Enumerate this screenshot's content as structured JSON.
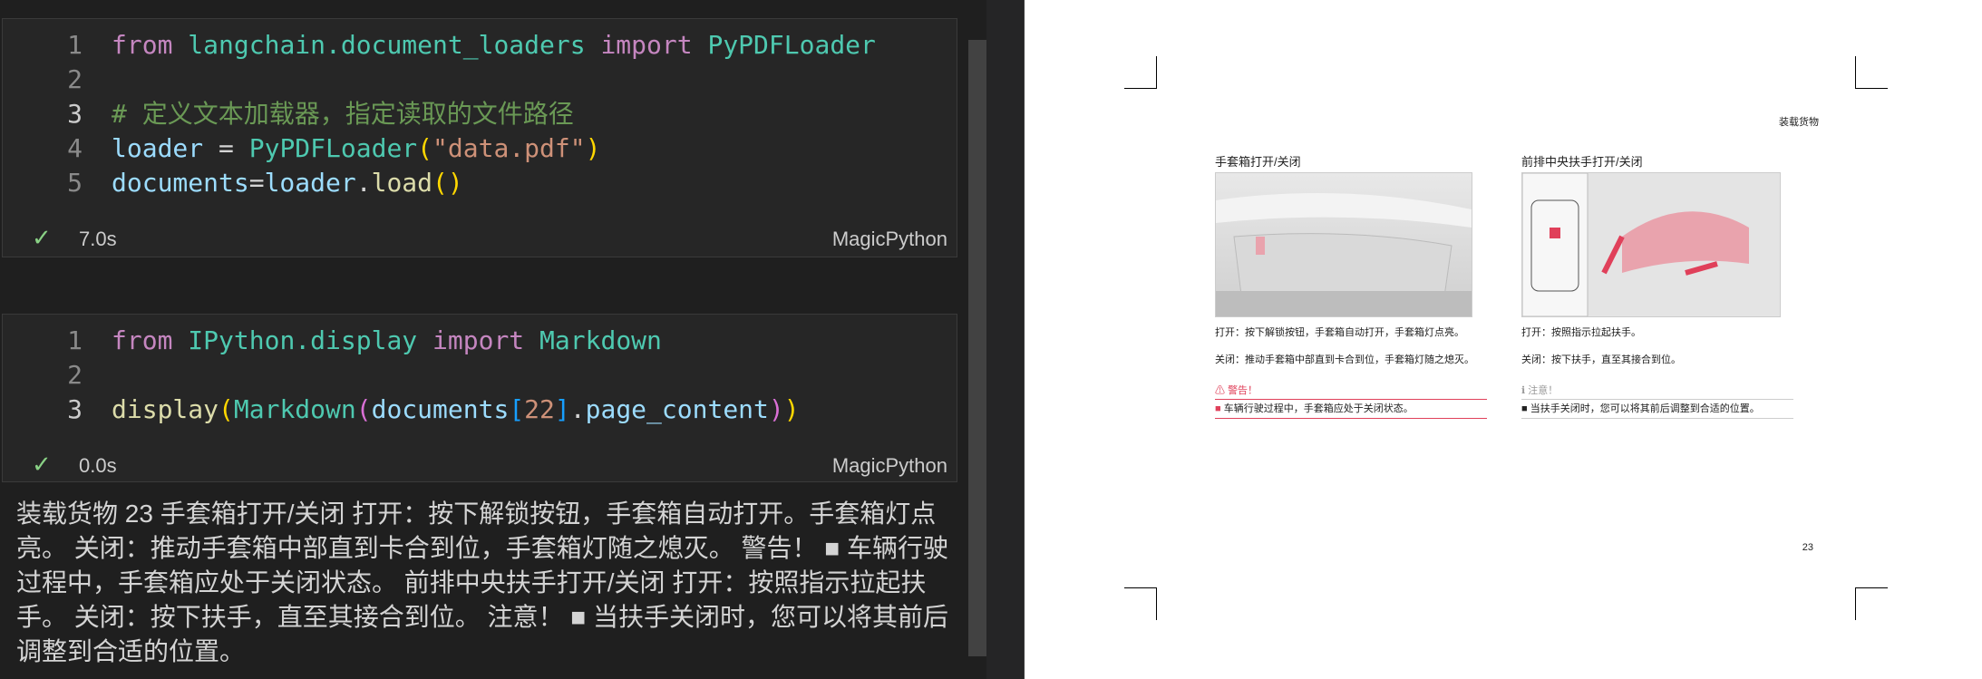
{
  "cell1": {
    "lines": [
      {
        "n": "1",
        "tokens": [
          [
            "kw",
            "from "
          ],
          [
            "mod",
            "langchain.document_loaders "
          ],
          [
            "kw",
            "import "
          ],
          [
            "cls",
            "PyPDFLoader"
          ]
        ]
      },
      {
        "n": "2",
        "tokens": []
      },
      {
        "n": "3",
        "tokens": [
          [
            "cmt",
            "# 定义文本加载器，指定读取的文件路径"
          ]
        ]
      },
      {
        "n": "4",
        "tokens": [
          [
            "var",
            "loader "
          ],
          [
            "pn",
            "= "
          ],
          [
            "cls",
            "PyPDFLoader"
          ],
          [
            "br1",
            "("
          ],
          [
            "str",
            "\"data.pdf\""
          ],
          [
            "br1",
            ")"
          ]
        ]
      },
      {
        "n": "5",
        "tokens": [
          [
            "var",
            "documents"
          ],
          [
            "pn",
            "="
          ],
          [
            "var",
            "loader"
          ],
          [
            "pn",
            "."
          ],
          [
            "fn",
            "load"
          ],
          [
            "br1",
            "()"
          ]
        ]
      }
    ],
    "time": "7.0s",
    "language": "MagicPython"
  },
  "cell2": {
    "lines": [
      {
        "n": "1",
        "tokens": [
          [
            "kw",
            "from "
          ],
          [
            "mod",
            "IPython.display "
          ],
          [
            "kw",
            "import "
          ],
          [
            "cls",
            "Markdown"
          ]
        ]
      },
      {
        "n": "2",
        "tokens": []
      },
      {
        "n": "3",
        "tokens": [
          [
            "fn",
            "display"
          ],
          [
            "br1",
            "("
          ],
          [
            "cls",
            "Markdown"
          ],
          [
            "br2",
            "("
          ],
          [
            "var",
            "documents"
          ],
          [
            "br3",
            "["
          ],
          [
            "str",
            "22"
          ],
          [
            "br3",
            "]"
          ],
          [
            "pn",
            "."
          ],
          [
            "var",
            "page_content"
          ],
          [
            "br2",
            ")"
          ],
          [
            "br1",
            ")"
          ]
        ]
      }
    ],
    "time": "0.0s",
    "language": "MagicPython"
  },
  "output_text": "装载货物 23 手套箱打开/关闭 打开：按下解锁按钮，手套箱自动打开。手套箱灯点亮。 关闭：推动手套箱中部直到卡合到位，手套箱灯随之熄灭。 警告！ ■ 车辆行驶过程中，手套箱应处于关闭状态。 前排中央扶手打开/关闭 打开：按照指示拉起扶手。 关闭：按下扶手，直至其接合到位。 注意！ ■ 当扶手关闭时，您可以将其前后调整到合适的位置。",
  "pdf": {
    "header": "装载货物",
    "left_title": "手套箱打开/关闭",
    "left_open": "打开：按下解锁按钮，手套箱自动打开，手套箱灯点亮。",
    "left_close": "关闭：推动手套箱中部直到卡合到位，手套箱灯随之熄灭。",
    "warning_label": "警告！",
    "warning_text": "车辆行驶过程中，手套箱应处于关闭状态。",
    "right_title": "前排中央扶手打开/关闭",
    "right_open": "打开：按照指示拉起扶手。",
    "right_close": "关闭：按下扶手，直至其接合到位。",
    "note_label": "注意！",
    "note_text": "当扶手关闭时，您可以将其前后调整到合适的位置。",
    "page_number": "23"
  },
  "colors": {
    "warning": "#e0405a",
    "check": "#89d185"
  }
}
